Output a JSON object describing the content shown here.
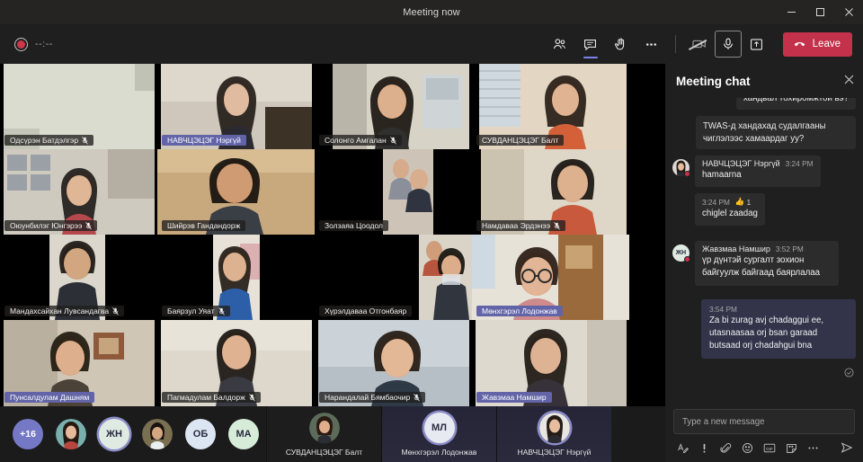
{
  "window": {
    "title": "Meeting now",
    "minimize_label": "Minimize",
    "restore_label": "Restore",
    "close_label": "Close"
  },
  "toolbar": {
    "recording_timer": "--:--",
    "people_label": "Show participants",
    "chat_label": "Show conversation",
    "raise_hand_label": "Raise hand",
    "more_label": "More actions",
    "camera_label": "Turn camera on",
    "mic_label": "Mute",
    "share_label": "Share content",
    "leave_label": "Leave"
  },
  "stage": {
    "tiles": [
      {
        "name": "Одсүрэн Батдэлгэр",
        "muted": true,
        "speaking": false
      },
      {
        "name": "НАВЧЦЭЦЭГ Нэргүй",
        "muted": false,
        "speaking": true
      },
      {
        "name": "Солонго Амгалан",
        "muted": true,
        "speaking": false
      },
      {
        "name": "СУВДАНЦЭЦЭГ Балт",
        "muted": false,
        "speaking": false
      },
      {
        "name": "Оюунбилэг Юнгэрээ",
        "muted": true,
        "speaking": false
      },
      {
        "name": "Шийрэв Гандандорж",
        "muted": false,
        "speaking": false
      },
      {
        "name": "Золзаяа Цоодол",
        "muted": false,
        "speaking": false
      },
      {
        "name": "Намдаваа Эрдэнээ",
        "muted": true,
        "speaking": false
      },
      {
        "name": "Мандахсайхан Лувсандагва",
        "muted": true,
        "speaking": false
      },
      {
        "name": "Баярзул Уяат",
        "muted": true,
        "speaking": false
      },
      {
        "name": "Хүрэлдаваа Отгонбаяр",
        "muted": false,
        "speaking": false
      },
      {
        "name": "Мөнхгэрэл Лодонжав",
        "muted": false,
        "speaking": true
      },
      {
        "name": "Пунсалдулам  Дашням",
        "muted": false,
        "speaking": true
      },
      {
        "name": "Пагмадулам Балдорж",
        "muted": true,
        "speaking": false
      },
      {
        "name": "Нарандалай Бямбаочир",
        "muted": true,
        "speaking": false
      },
      {
        "name": "Жавзмаа Намшир",
        "muted": false,
        "speaking": true
      }
    ]
  },
  "roster": {
    "overflow_count": "+16",
    "avatars": [
      {
        "initials": "",
        "ring": false
      },
      {
        "initials": "ЖН",
        "ring": true
      },
      {
        "initials": "",
        "ring": false
      },
      {
        "initials": "ОБ",
        "ring": false
      },
      {
        "initials": "МА",
        "ring": false
      }
    ],
    "named_tiles": [
      {
        "name": "СУВДАНЦЭЦЭГ Балт",
        "initials": "",
        "ring": false,
        "photo": true
      },
      {
        "name": "Мөнхгэрэл Лодонжав",
        "initials": "МЛ",
        "ring": true,
        "photo": false
      },
      {
        "name": "НАВЧЦЭЦЭГ Нэргүй",
        "initials": "",
        "ring": true,
        "photo": true
      }
    ]
  },
  "chat": {
    "title": "Meeting chat",
    "close_label": "Close",
    "messages": [
      {
        "kind": "plain_clipped",
        "text": "хандвал тохиромжтой вэ?"
      },
      {
        "kind": "plain",
        "text": "TWAS-д хандахад судалгааны чиглэлээс хамаардаг уу?"
      },
      {
        "kind": "other",
        "sender": "НАВЧЦЭЦЭГ Нэргүй",
        "initials": "",
        "time": "3:24 PM",
        "text": "hamaarna"
      },
      {
        "kind": "other_continued",
        "time": "3:24 PM",
        "reaction_emoji": "👍",
        "reaction_count": "1",
        "text": "chiglel zaadag"
      },
      {
        "kind": "other",
        "sender": "Жавзмаа Намшир",
        "initials": "ЖН",
        "time": "3:52 PM",
        "text": "үр дүнтэй сургалт зохион байгуулж байгаад баярлалаа"
      },
      {
        "kind": "self",
        "time": "3:54 PM",
        "text": "Za bi zurag avj chadaggui ee, utasnaasaa orj bsan garaad butsaad orj chadahgui bna",
        "status": "Sent"
      }
    ],
    "compose": {
      "placeholder": "Type a new message",
      "format_label": "Format",
      "important_label": "Set delivery options",
      "attach_label": "Attach file",
      "emoji_label": "Emoji",
      "giphy_label": "Giphy",
      "sticker_label": "Sticker",
      "more_label": "More options",
      "send_label": "Send"
    }
  },
  "colors": {
    "accent": "#6264a7",
    "leave": "#c4314b",
    "record": "#d0364a"
  }
}
